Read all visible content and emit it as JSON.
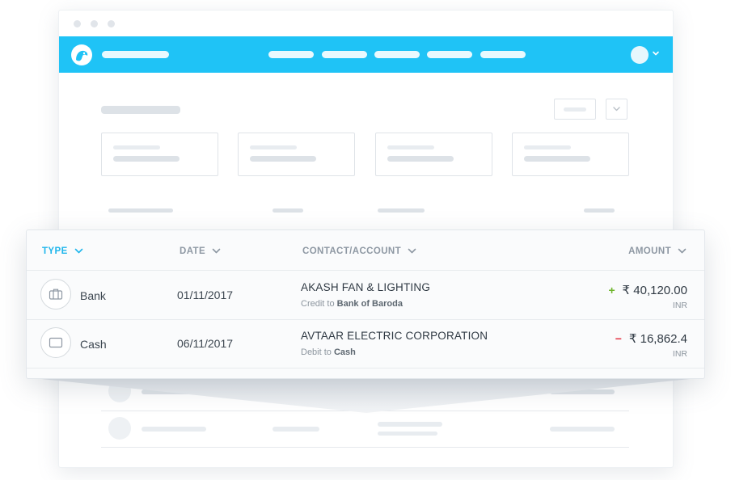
{
  "table": {
    "headers": {
      "type": "TYPE",
      "date": "DATE",
      "contact": "CONTACT/ACCOUNT",
      "amount": "AMOUNT"
    },
    "active_sort": "type",
    "rows": [
      {
        "type": "Bank",
        "type_icon": "briefcase-icon",
        "date": "01/11/2017",
        "contact": "AKASH FAN & LIGHTING",
        "direction": "Credit to",
        "account": "Bank of Baroda",
        "sign": "+",
        "amount": "₹ 40,120.00",
        "currency": "INR"
      },
      {
        "type": "Cash",
        "type_icon": "cash-icon",
        "date": "06/11/2017",
        "contact": "AVTAAR ELECTRIC CORPORATION",
        "direction": "Debit to",
        "account": "Cash",
        "sign": "−",
        "amount": "₹ 16,862.4",
        "currency": "INR"
      }
    ]
  },
  "colors": {
    "accent": "#1fc3f6",
    "active_header": "#1fb6ec",
    "credit": "#6fb52c",
    "debit": "#e53544"
  }
}
